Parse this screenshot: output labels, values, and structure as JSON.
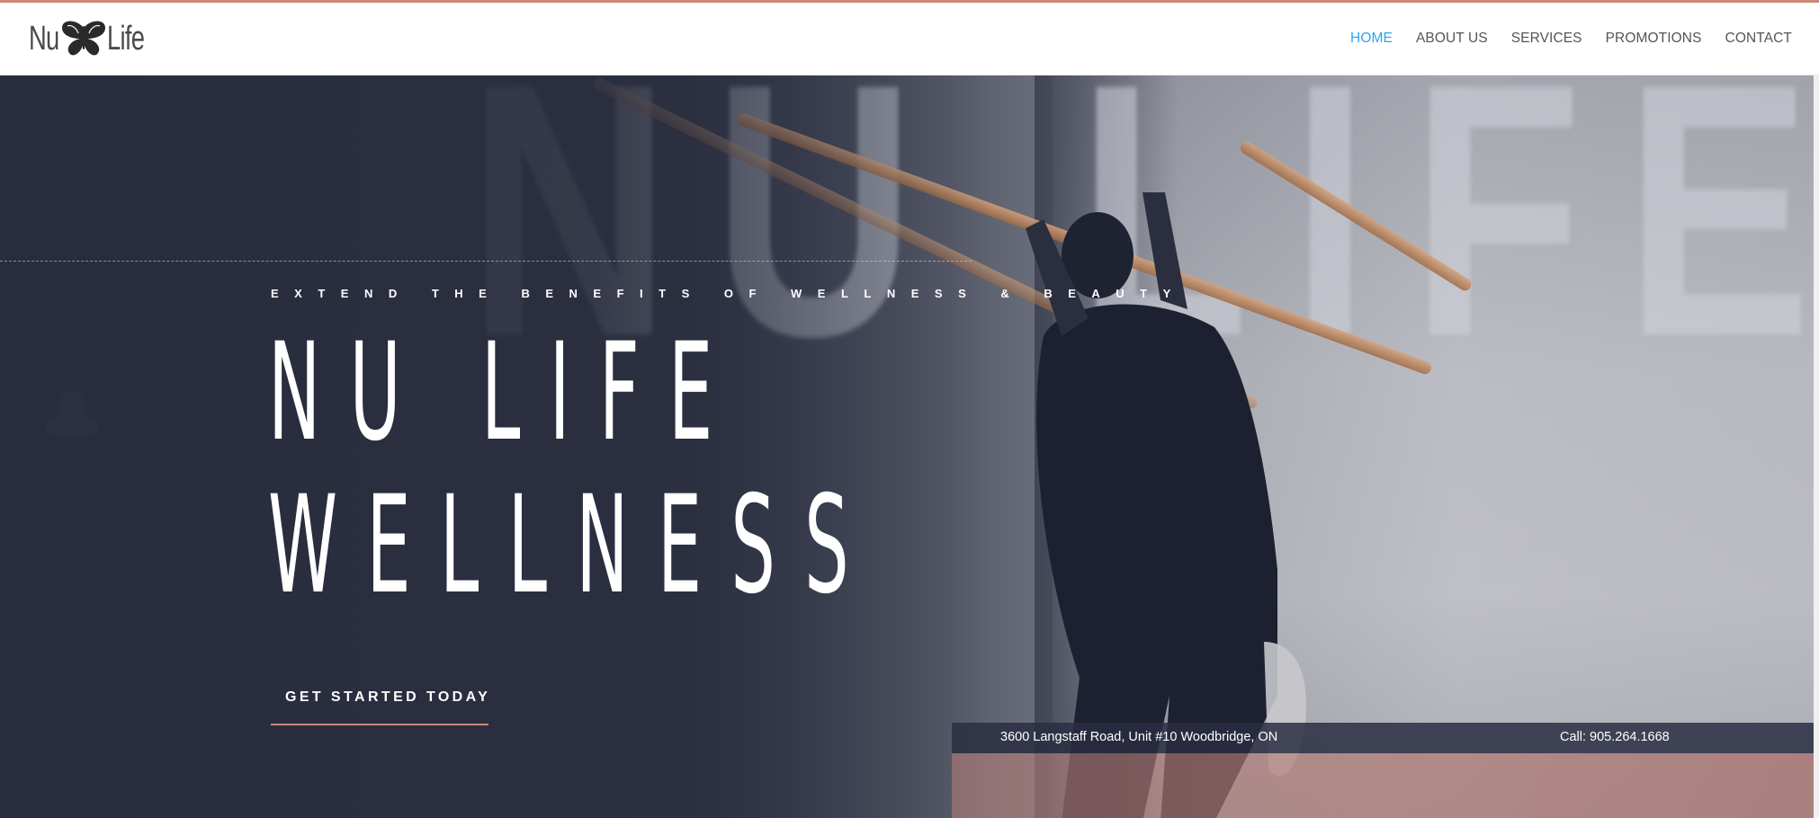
{
  "brand": {
    "logo_left": "Nu",
    "logo_right": "Life",
    "logo_icon": "butterfly-icon"
  },
  "nav": {
    "items": [
      {
        "label": "HOME",
        "active": true
      },
      {
        "label": "ABOUT US",
        "active": false
      },
      {
        "label": "SERVICES",
        "active": false
      },
      {
        "label": "PROMOTIONS",
        "active": false
      },
      {
        "label": "CONTACT",
        "active": false
      }
    ]
  },
  "hero": {
    "watermark": "NU LIFE",
    "kicker": "EXTEND THE BENEFITS OF WELLNESS & BEAUTY",
    "title_line1": "NU LIFE",
    "title_line2": "WELLNESS",
    "cta_label": "GET STARTED TODAY"
  },
  "info_bar": {
    "address": "3600 Langstaff Road, Unit #10 Woodbridge, ON",
    "phone": "Call: 905.264.1668"
  },
  "colors": {
    "accent": "#c98a78",
    "nav_active": "#2ea3f2",
    "nav_text": "#555555",
    "hero_dark": "#2b3042"
  }
}
